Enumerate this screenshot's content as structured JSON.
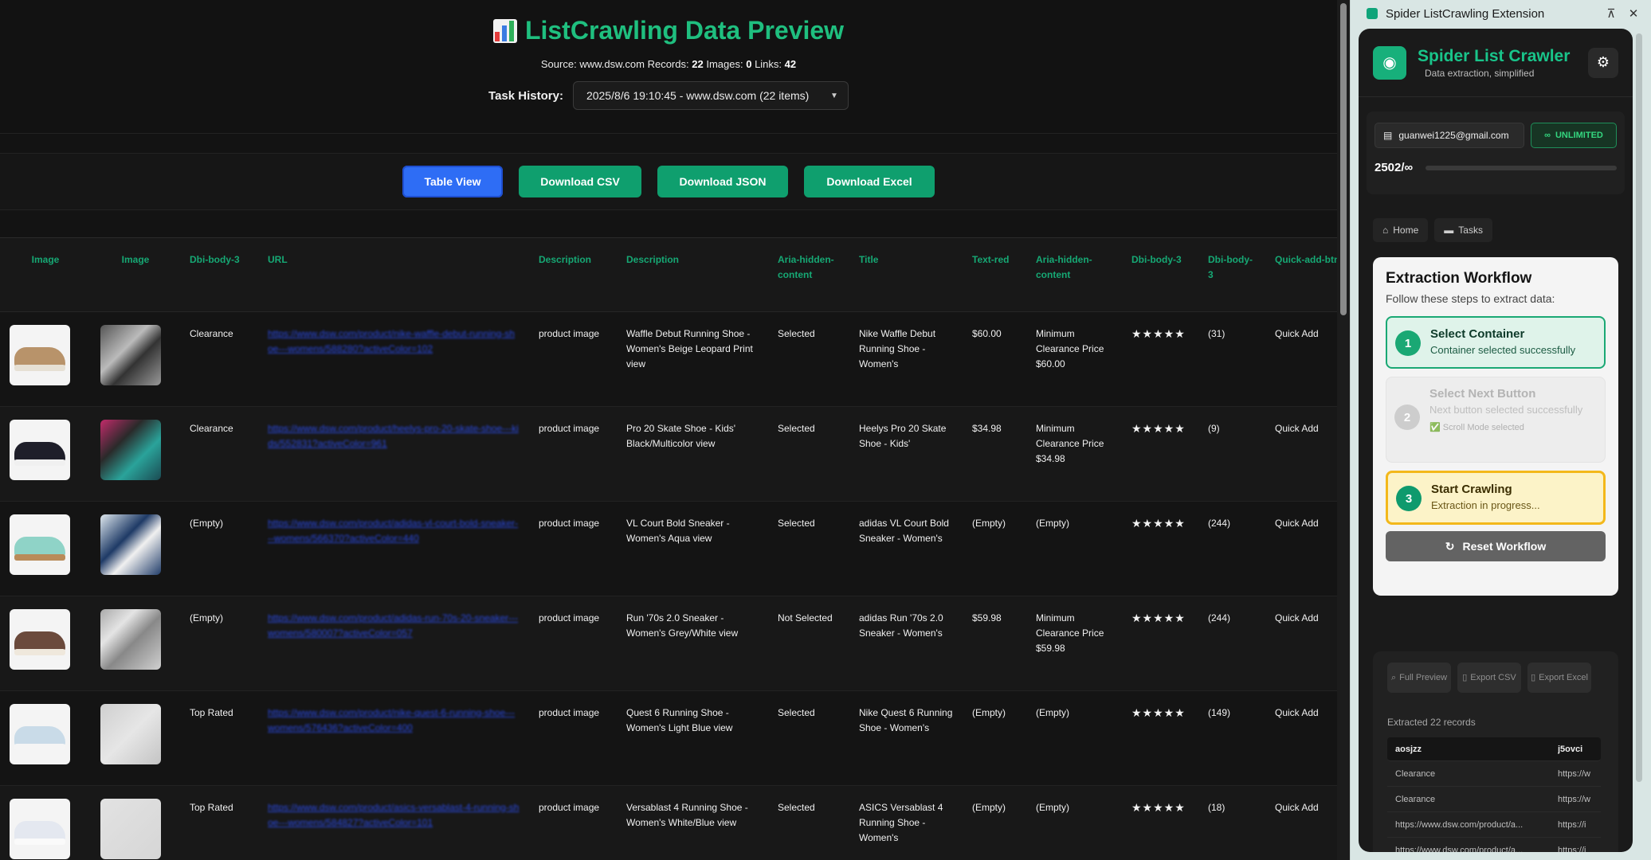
{
  "header": {
    "title": "ListCrawling Data Preview",
    "source_label": "Source:",
    "source": "www.dsw.com",
    "records_label": "Records:",
    "records": "22",
    "images_label": "Images:",
    "images": "0",
    "links_label": "Links:",
    "links": "42",
    "history_label": "Task History:",
    "history_value": "2025/8/6 19:10:45 - www.dsw.com (22 items)"
  },
  "toolbar": {
    "table_view": "Table View",
    "download_csv": "Download CSV",
    "download_json": "Download JSON",
    "download_excel": "Download Excel"
  },
  "table": {
    "headers": [
      "Image",
      "Image",
      "Dbi-body-3",
      "URL",
      "Description",
      "Description",
      "Aria-hidden-content",
      "Title",
      "Text-red",
      "Aria-hidden-content",
      "Dbi-body-3",
      "Dbi-body-3",
      "Quick-add-btn"
    ],
    "rows": [
      {
        "tag": "Clearance",
        "url": "https://www.dsw.com/product/nike-waffle-debut-running-shoe---womens/588280?activeColor=102",
        "desc1": "product image",
        "desc2": "Waffle Debut Running Shoe - Women's Beige Leopard Print view",
        "aria": "Selected",
        "title": "Nike Waffle Debut Running Shoe - Women's",
        "price": "$60.00",
        "aria2": "Minimum Clearance Price $60.00",
        "stars": "★★★★★",
        "count": "(31)",
        "quick": "Quick Add"
      },
      {
        "tag": "Clearance",
        "url": "https://www.dsw.com/product/heelys-pro-20-skate-shoe---kids/552831?activeColor=961",
        "desc1": "product image",
        "desc2": "Pro 20 Skate Shoe - Kids' Black/Multicolor view",
        "aria": "Selected",
        "title": "Heelys Pro 20 Skate Shoe - Kids'",
        "price": "$34.98",
        "aria2": "Minimum Clearance Price $34.98",
        "stars": "★★★★★",
        "count": "(9)",
        "quick": "Quick Add"
      },
      {
        "tag": "(Empty)",
        "url": "https://www.dsw.com/product/adidas-vl-court-bold-sneaker---womens/566370?activeColor=440",
        "desc1": "product image",
        "desc2": "VL Court Bold Sneaker - Women's Aqua view",
        "aria": "Selected",
        "title": "adidas VL Court Bold Sneaker - Women's",
        "price": "(Empty)",
        "aria2": "(Empty)",
        "stars": "★★★★★",
        "count": "(244)",
        "quick": "Quick Add"
      },
      {
        "tag": "(Empty)",
        "url": "https://www.dsw.com/product/adidas-run-70s-20-sneaker---womens/580007?activeColor=057",
        "desc1": "product image",
        "desc2": "Run '70s 2.0 Sneaker - Women's Grey/White view",
        "aria": "Not Selected",
        "title": "adidas Run '70s 2.0 Sneaker - Women's",
        "price": "$59.98",
        "aria2": "Minimum Clearance Price $59.98",
        "stars": "★★★★★",
        "count": "(244)",
        "quick": "Quick Add"
      },
      {
        "tag": "Top Rated",
        "url": "https://www.dsw.com/product/nike-quest-6-running-shoe---womens/576436?activeColor=400",
        "desc1": "product image",
        "desc2": "Quest 6 Running Shoe - Women's Light Blue view",
        "aria": "Selected",
        "title": "Nike Quest 6 Running Shoe - Women's",
        "price": "(Empty)",
        "aria2": "(Empty)",
        "stars": "★★★★★",
        "count": "(149)",
        "quick": "Quick Add"
      },
      {
        "tag": "Top Rated",
        "url": "https://www.dsw.com/product/asics-versablast-4-running-shoe---womens/584827?activeColor=101",
        "desc1": "product image",
        "desc2": "Versablast 4 Running Shoe - Women's White/Blue view",
        "aria": "Selected",
        "title": "ASICS Versablast 4 Running Shoe - Women's",
        "price": "(Empty)",
        "aria2": "(Empty)",
        "stars": "★★★★★",
        "count": "(18)",
        "quick": "Quick Add"
      }
    ]
  },
  "panel": {
    "window_title": "Spider ListCrawling Extension",
    "app_name": "Spider List Crawler",
    "tagline": "Data extraction, simplified",
    "email": "guanwei1225@gmail.com",
    "plan": "UNLIMITED",
    "quota": "2502/∞",
    "nav_home": "Home",
    "nav_tasks": "Tasks",
    "workflow_title": "Extraction Workflow",
    "workflow_sub": "Follow these steps to extract data:",
    "step1_num": "1",
    "step1_title": "Select Container",
    "step1_sub": "Container selected successfully",
    "step2_num": "2",
    "step2_title": "Select Next Button",
    "step2_sub": "Next button selected successfully",
    "step2_note": "✅ Scroll Mode selected",
    "step3_num": "3",
    "step3_title": "Start Crawling",
    "step3_sub": "Extraction in progress...",
    "reset": "Reset Workflow",
    "ex_full": "Full Preview",
    "ex_csv": "Export CSV",
    "ex_excel": "Export Excel",
    "extracted": "Extracted 22 records",
    "mini_headers": [
      "aosjzz",
      "j5ovci"
    ],
    "mini_rows": [
      [
        "Clearance",
        "https://w"
      ],
      [
        "Clearance",
        "https://w"
      ],
      [
        "https://www.dsw.com/product/a...",
        "https://i"
      ],
      [
        "https://www.dsw.com/product/a...",
        "https://i"
      ]
    ]
  },
  "colors": {
    "accent_green": "#1fbf7f",
    "table_header_green": "#16a874",
    "blue_button": "#2e6df5",
    "green_button": "#0f9f6e",
    "step_active": "#1aa874",
    "step_progress": "#f3b81b"
  }
}
